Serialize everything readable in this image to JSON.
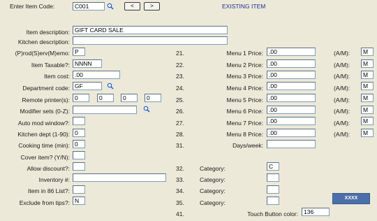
{
  "header": {
    "item_code_label": "Enter Item Code:",
    "item_code_value": "C001",
    "prev_label": "<",
    "next_label": ">",
    "status": "EXISTING ITEM"
  },
  "left": {
    "description_label": "Item description:",
    "description_value": "GIFT CARD SALE",
    "kitchen_description_label": "Kitchen description:",
    "kitchen_description_value": "",
    "type_label": "(P)rod(S)erv(M)emo:",
    "type_value": "P",
    "taxable_label": "Item Taxable?:",
    "taxable_value": "NNNN",
    "cost_label": "Item cost:",
    "cost_value": ".00",
    "department_label": "Department code:",
    "department_value": "GF",
    "printers_label": "Remote printer(s):",
    "printers_values": [
      "0",
      "0",
      "0",
      "0"
    ],
    "modifier_label": "Modifier sets (0-Z):",
    "modifier_value": "",
    "auto_mod_label": "Auto mod window?:",
    "auto_mod_value": "",
    "kitchen_dept_label": "Kitchen dept (1-90):",
    "kitchen_dept_value": "0",
    "cooking_time_label": "Cooking time (min):",
    "cooking_time_value": "0",
    "cover_label": "Cover item? (Y/N):",
    "cover_value": "",
    "discount_label": "Allow discount?:",
    "discount_value": "",
    "inventory_label": "Inventory #:",
    "inventory_value": "",
    "list86_label": "Item in 86 List?:",
    "list86_value": "",
    "tips_label": "Exclude from tips?:",
    "tips_value": "N"
  },
  "menu_prices": [
    {
      "num": "21.",
      "label": "Menu 1 Price:",
      "value": ".00",
      "am_label": "(A/M):",
      "am_value": "M"
    },
    {
      "num": "22.",
      "label": "Menu 2 Price:",
      "value": ".00",
      "am_label": "(A/M):",
      "am_value": "M"
    },
    {
      "num": "23.",
      "label": "Menu 3 Price:",
      "value": ".00",
      "am_label": "(A/M):",
      "am_value": "M"
    },
    {
      "num": "24.",
      "label": "Menu 4 Price:",
      "value": ".00",
      "am_label": "(A/M):",
      "am_value": "M"
    },
    {
      "num": "25.",
      "label": "Menu 5 Price:",
      "value": ".00",
      "am_label": "(A/M):",
      "am_value": "M"
    },
    {
      "num": "26.",
      "label": "Menu 6 Price:",
      "value": ".00",
      "am_label": "(A/M):",
      "am_value": "M"
    },
    {
      "num": "27.",
      "label": "Menu 7 Price:",
      "value": ".00",
      "am_label": "(A/M):",
      "am_value": "M"
    },
    {
      "num": "28.",
      "label": "Menu 8 Price:",
      "value": ".00",
      "am_label": "(A/M):",
      "am_value": "M"
    }
  ],
  "days": {
    "num": "31.",
    "label": "Days/week:",
    "value": ""
  },
  "categories": [
    {
      "num": "32.",
      "label": "Category:",
      "value": "C"
    },
    {
      "num": "33.",
      "label": "Category:",
      "value": ""
    },
    {
      "num": "34.",
      "label": "Category:",
      "value": ""
    },
    {
      "num": "35.",
      "label": "Category:",
      "value": ""
    }
  ],
  "touch_button": {
    "num": "41.",
    "label": "Touch Button color:",
    "value": "136",
    "swatch_text": "XXXX",
    "swatch_color": "#4b6fa8"
  },
  "colors": {
    "background": "#ece9d8",
    "title": "#1c2f96",
    "input_border": "#7f9db9"
  }
}
